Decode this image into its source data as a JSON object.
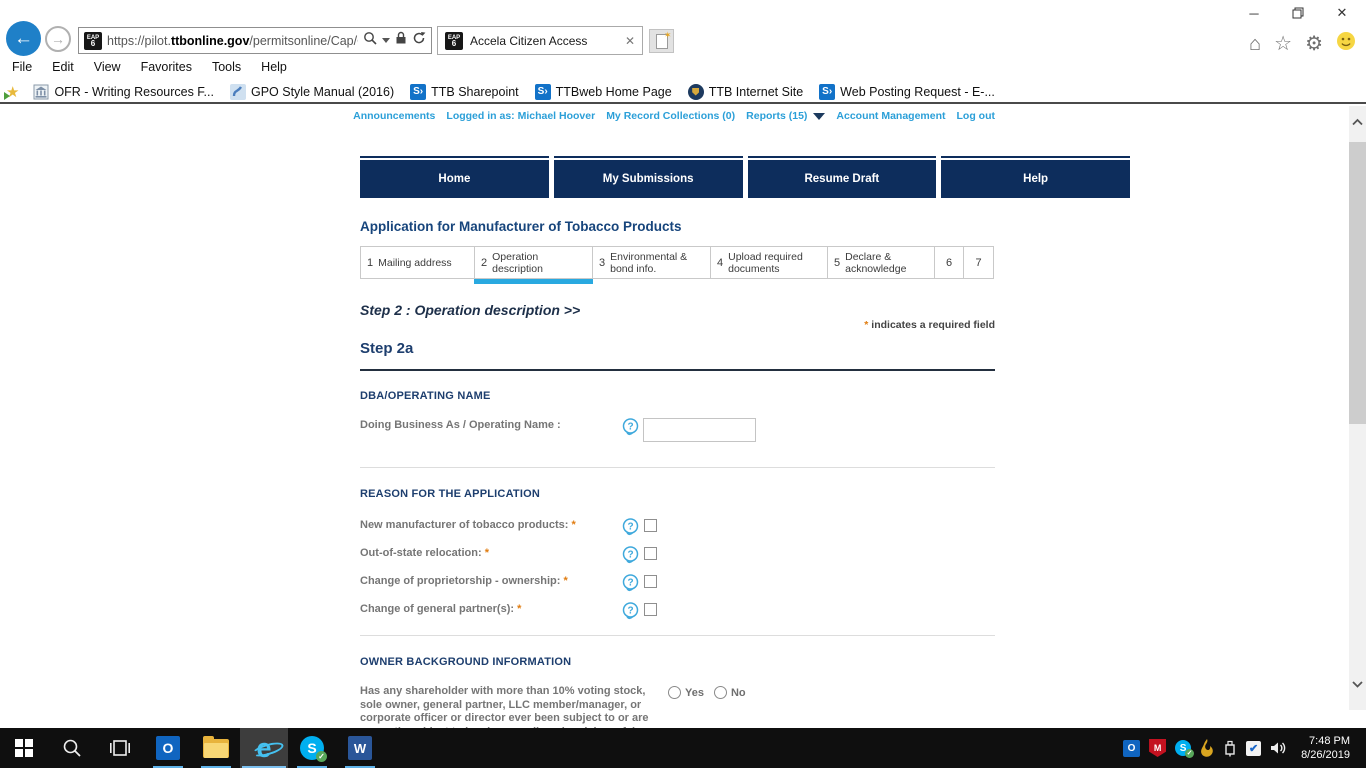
{
  "browser": {
    "url_prefix": "https://pilot.",
    "url_domain": "ttbonline.gov",
    "url_path": "/permitsonline/Cap/Cap",
    "favicon_top": "EAP",
    "favicon_bottom": "6",
    "tab_title": "Accela Citizen Access",
    "menu": [
      "File",
      "Edit",
      "View",
      "Favorites",
      "Tools",
      "Help"
    ],
    "favorites": [
      {
        "label": "OFR - Writing Resources F..."
      },
      {
        "label": "GPO Style Manual (2016)"
      },
      {
        "label": "TTB Sharepoint"
      },
      {
        "label": "TTBweb Home Page"
      },
      {
        "label": "TTB Internet Site"
      },
      {
        "label": "Web Posting Request - E-..."
      }
    ]
  },
  "page": {
    "header_links": [
      "Announcements",
      "Logged in as: Michael Hoover",
      "My Record Collections (0)",
      "Reports (15)",
      "Account Management",
      "Log out"
    ],
    "nav_buttons": [
      "Home",
      "My Submissions",
      "Resume Draft",
      "Help"
    ],
    "title": "Application for Manufacturer of Tobacco Products",
    "steps": [
      {
        "num": "1",
        "label": "Mailing address"
      },
      {
        "num": "2",
        "label": "Operation description"
      },
      {
        "num": "3",
        "label": "Environmental & bond info."
      },
      {
        "num": "4",
        "label": "Upload required documents"
      },
      {
        "num": "5",
        "label": "Declare & acknowledge"
      },
      {
        "num": "6",
        "label": ""
      },
      {
        "num": "7",
        "label": ""
      }
    ],
    "step_heading": "Step 2 : Operation description >>",
    "required_mark": "*",
    "required_note_text": " indicates a required field",
    "sub_heading": "Step 2a",
    "sections": {
      "dba": {
        "title": "DBA/OPERATING NAME",
        "label": "Doing Business As / Operating Name :",
        "value": ""
      },
      "reason": {
        "title": "REASON FOR THE APPLICATION",
        "items": [
          "New manufacturer of tobacco products:",
          "Out-of-state relocation:",
          "Change of proprietorship - ownership:",
          "Change of general partner(s):"
        ]
      },
      "owner": {
        "title": "OWNER BACKGROUND INFORMATION",
        "question": "Has any shareholder with more than 10% voting stock, sole owner, general partner, LLC member/manager, or corporate officer or director ever been subject to or are currently subject to legal proceedings involving a felony",
        "options": [
          "Yes",
          "No"
        ]
      }
    }
  },
  "taskbar": {
    "time": "7:48 PM",
    "date": "8/26/2019"
  },
  "colors": {
    "link_blue": "#2b9fd8",
    "navy_button": "#0d2d5c",
    "heading_navy": "#1d3e6e",
    "title_blue": "#17457c",
    "required_orange": "#e07c10",
    "tab_active_blue": "#29a9e0",
    "help_icon_blue": "#3fa9dc",
    "back_button_blue": "#1f80c8"
  }
}
